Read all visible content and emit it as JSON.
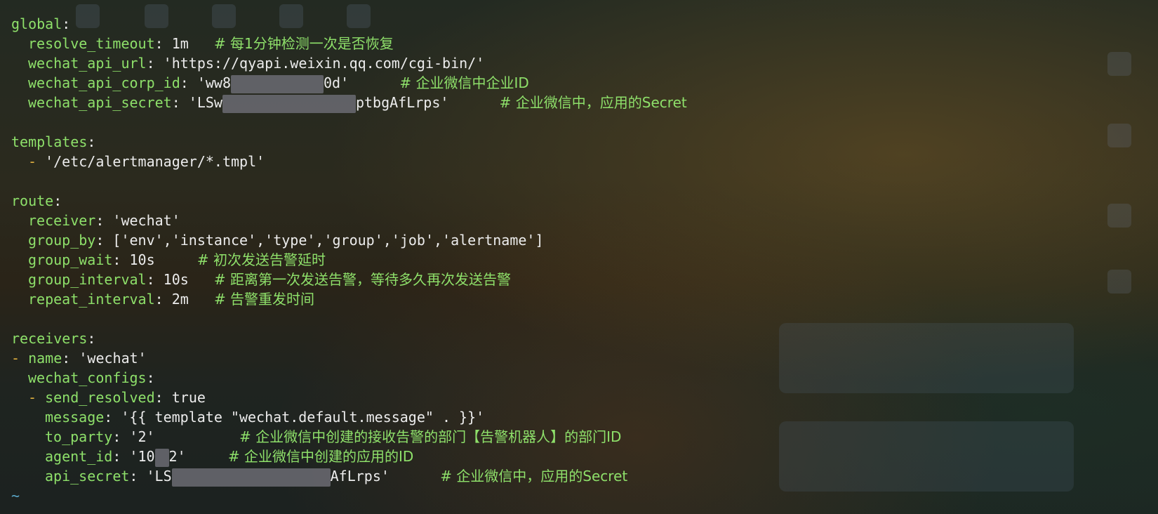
{
  "terminal": {
    "global_key": "global",
    "resolve_timeout_key": "resolve_timeout",
    "resolve_timeout_val": "1m",
    "resolve_timeout_comment": "# 每1分钟检测一次是否恢复",
    "wechat_api_url_key": "wechat_api_url",
    "wechat_api_url_val": "'https://qyapi.weixin.qq.com/cgi-bin/'",
    "corp_id_key": "wechat_api_corp_id",
    "corp_id_val_start": "'ww8",
    "corp_id_val_end": "0d'",
    "corp_id_comment": "# 企业微信中企业ID",
    "secret_key": "wechat_api_secret",
    "secret_val_start": "'LSw",
    "secret_val_end": "ptbgAfLrps'",
    "secret_comment": "# 企业微信中，应用的Secret",
    "templates_key": "templates",
    "template_item": "'/etc/alertmanager/*.tmpl'",
    "route_key": "route",
    "receiver_key": "receiver",
    "receiver_val": "'wechat'",
    "group_by_key": "group_by",
    "group_by_val": "['env','instance','type','group','job','alertname']",
    "group_wait_key": "group_wait",
    "group_wait_val": "10s",
    "group_wait_comment": "# 初次发送告警延时",
    "group_interval_key": "group_interval",
    "group_interval_val": "10s",
    "group_interval_comment": "# 距离第一次发送告警，等待多久再次发送告警",
    "repeat_interval_key": "repeat_interval",
    "repeat_interval_val": "2m",
    "repeat_interval_comment": "# 告警重发时间",
    "receivers_key": "receivers",
    "name_key": "name",
    "name_val": "'wechat'",
    "wechat_configs_key": "wechat_configs",
    "send_resolved_key": "send_resolved",
    "send_resolved_val": "true",
    "message_key": "message",
    "message_val": "'{{ template \"wechat.default.message\" . }}'",
    "to_party_key": "to_party",
    "to_party_val": "'2'",
    "to_party_comment": "# 企业微信中创建的接收告警的部门【告警机器人】的部门ID",
    "agent_id_key": "agent_id",
    "agent_id_val_start": "'10",
    "agent_id_val_end": "2'",
    "agent_id_comment": "# 企业微信中创建的应用的ID",
    "api_secret_key": "api_secret",
    "api_secret_val_start": "'LS",
    "api_secret_val_end": "AfLrps'",
    "api_secret_comment": "# 企业微信中，应用的Secret",
    "tilde": "~"
  },
  "colors": {
    "key": "#8ee06a",
    "comment": "#8ee06a",
    "dash": "#e0b040",
    "text": "#ececec",
    "tilde": "#5aa7c8"
  }
}
